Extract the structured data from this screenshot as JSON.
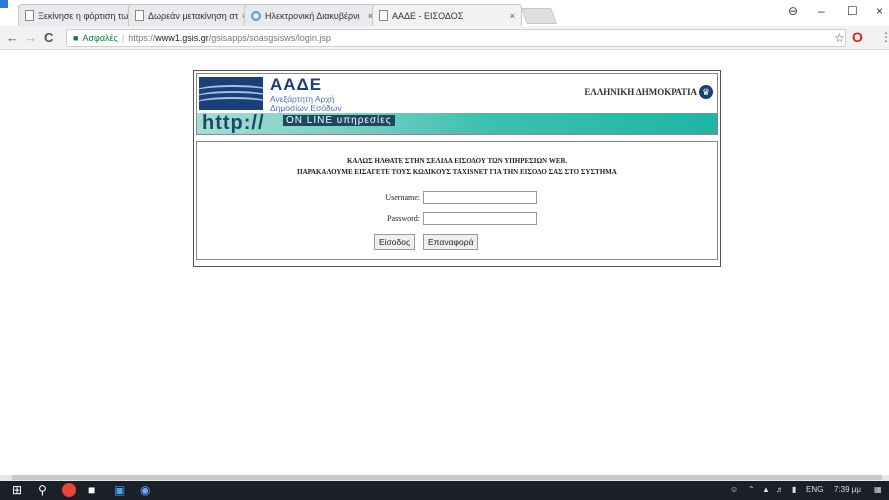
{
  "browser": {
    "tabs": [
      {
        "label": "Ξεκίνησε η φόρτιση των",
        "close": "×"
      },
      {
        "label": "Δωρεάν μετακίνηση στο",
        "close": "×"
      },
      {
        "label": "Ηλεκτρονική Διακυβέρνι",
        "close": "×"
      },
      {
        "label": "ΑΑΔΕ - ΕΙΣΟΔΟΣ",
        "close": "×"
      }
    ],
    "window": {
      "user": "⊖",
      "minimize": "–",
      "maximize": "☐",
      "close": "×"
    },
    "nav": {
      "back": "←",
      "forward": "→",
      "reload": "C"
    },
    "address": {
      "secure_label": "Ασφαλές",
      "scheme": "https://",
      "host": "www1.gsis.gr",
      "path": "/gsisapps/soasgsisws/login.jsp"
    },
    "bookmark_icon": "☆",
    "opera_icon": "O",
    "menu_icon": "⋮"
  },
  "banner": {
    "brand": "ΑΑΔΕ",
    "subtitle_line1": "Ανεξάρτητη Αρχή",
    "subtitle_line2": "Δημοσίων Εσόδων",
    "republic": "ΕΛΛΗΝΙΚΗ ΔΗΜΟΚΡΑΤΙΑ",
    "http_text": "http://",
    "online_text": "ON LINE υπηρεσίες"
  },
  "login": {
    "welcome_line1": "ΚΑΛΩΣ ΗΛΘΑΤΕ ΣΤΗΝ ΣΕΛΙΔΑ ΕΙΣΟΔΟΥ ΤΩΝ ΥΠΗΡΕΣΙΩΝ WEB.",
    "welcome_line2": "ΠΑΡΑΚΑΛΟΥΜΕ ΕΙΣΑΓΕΤΕ ΤΟΥΣ ΚΩΔΙΚΟΥΣ TAXISNET ΓΙΑ ΤΗΝ ΕΙΣΟΔΟ ΣΑΣ ΣΤΟ ΣΥΣΤΗΜΑ",
    "username_label": "Username:",
    "username_value": "",
    "password_label": "Password:",
    "password_value": "",
    "login_button": "Είσοδος",
    "reset_button": "Επαναφορά"
  },
  "taskbar": {
    "time": "7:39 μμ",
    "language": "ENG"
  },
  "colors": {
    "brand_blue": "#1d3f78",
    "teal": "#1fb5a4",
    "secure_green": "#0b8043"
  }
}
